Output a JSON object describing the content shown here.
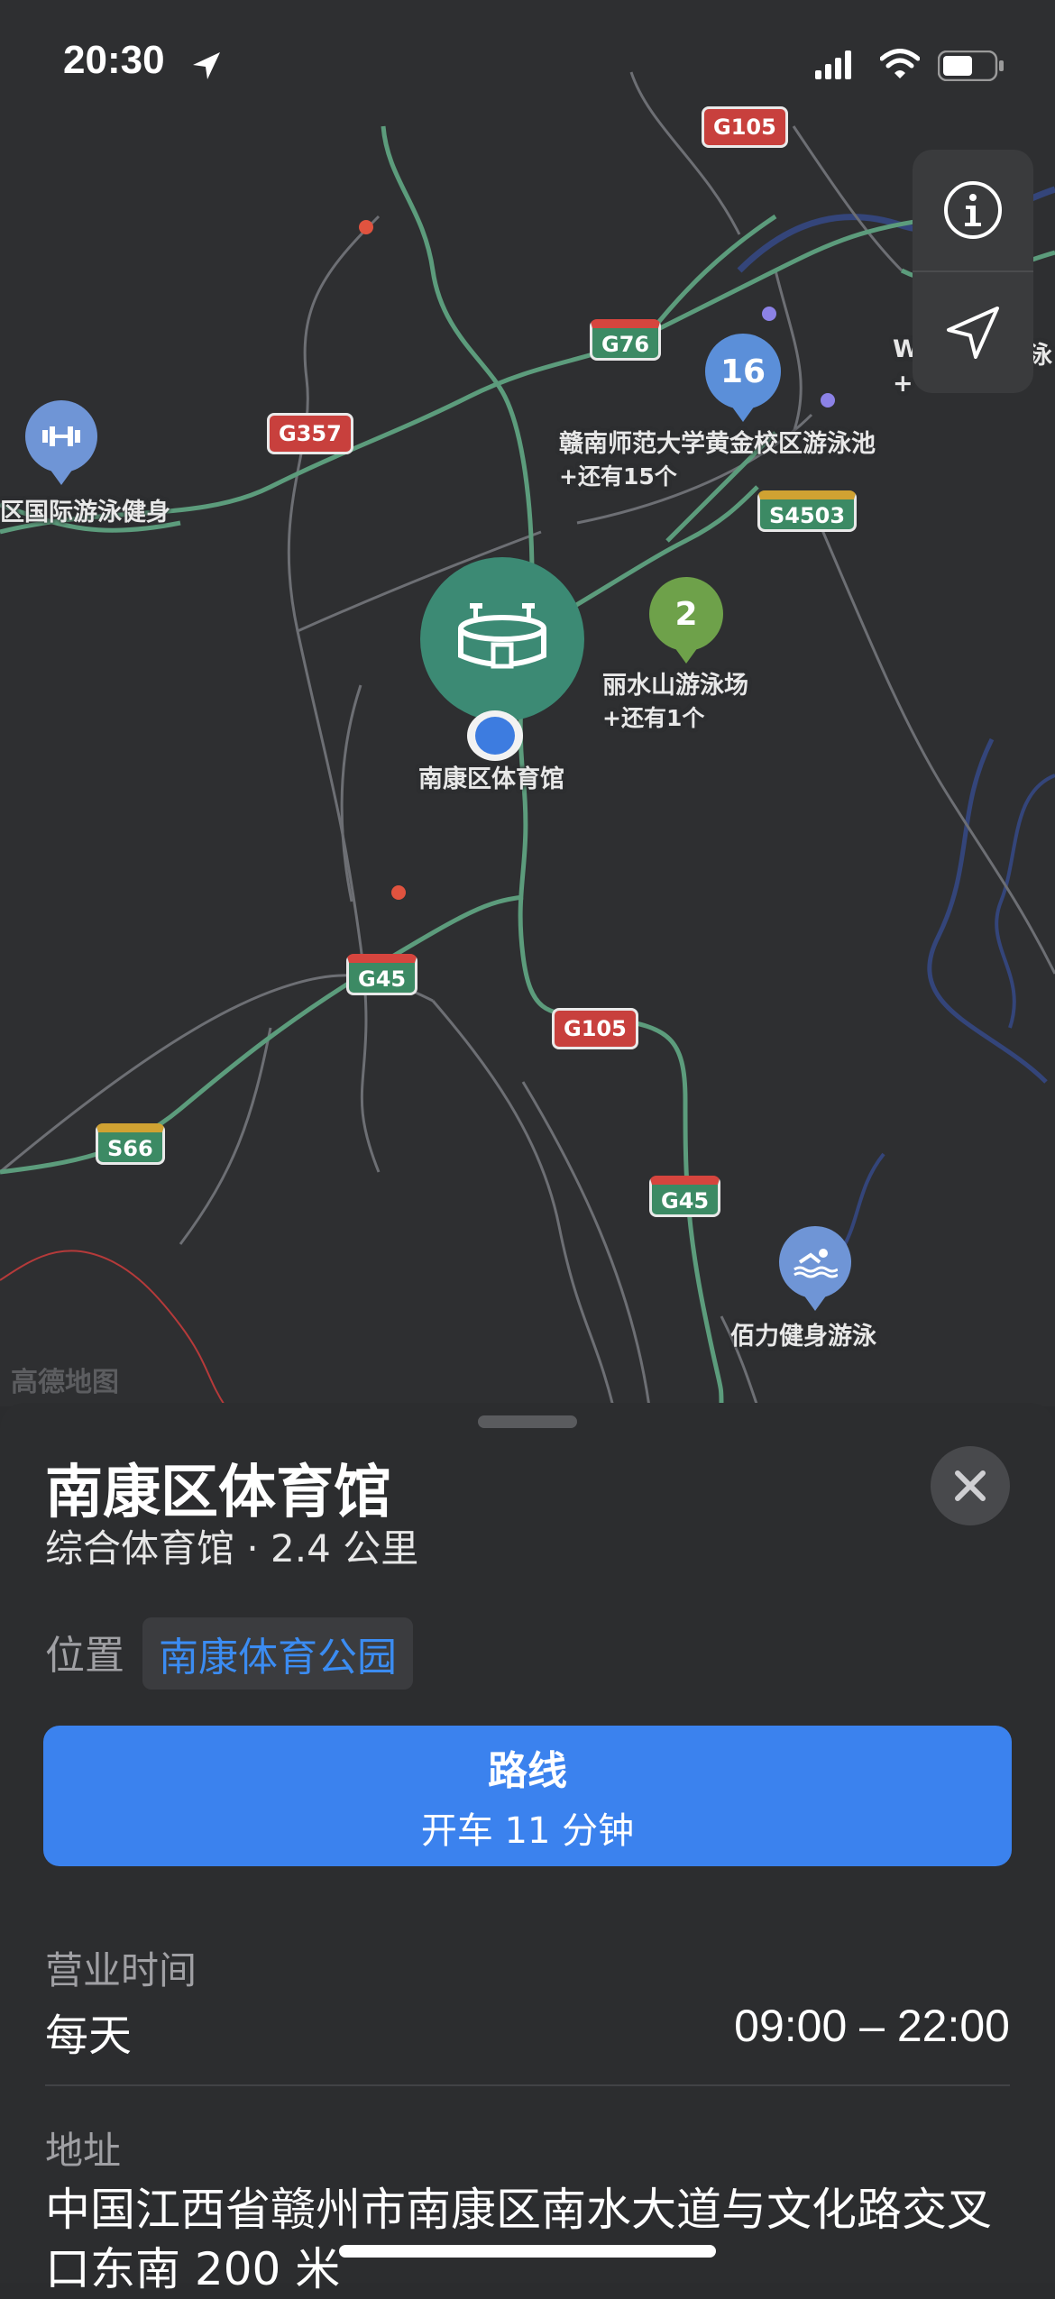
{
  "status_bar": {
    "time": "20:30"
  },
  "map": {
    "watermark": "高德地图",
    "shields": [
      {
        "id": "g105-top",
        "text": "G105"
      },
      {
        "id": "g76",
        "text": "G76"
      },
      {
        "id": "g357",
        "text": "G357"
      },
      {
        "id": "s4503",
        "text": "S4503"
      },
      {
        "id": "g45-a",
        "text": "G45"
      },
      {
        "id": "g105",
        "text": "G105"
      },
      {
        "id": "s66",
        "text": "S66"
      },
      {
        "id": "g45-b",
        "text": "G45"
      }
    ],
    "clusters": {
      "c16": {
        "count": "16",
        "label": "赣南师范大学黄金校区游泳池",
        "more": "+还有15个",
        "color": "#5b8fd9"
      },
      "c2": {
        "count": "2",
        "label": "丽水山游泳场",
        "more": "+还有1个",
        "color": "#6ea14a"
      }
    },
    "pois": {
      "gym_left_label": "区国际游泳健身",
      "selected_label": "南康区体育馆",
      "swim_label": "佰力健身游泳",
      "top_right_partial": "W",
      "top_right_partial_b": "泳",
      "top_right_partial_c": "+"
    },
    "colors": {
      "road_major": "#5c9c7c",
      "road_minor": "#6d6f74",
      "river": "#34457a",
      "selected_pin": "#3c8a74"
    }
  },
  "sheet": {
    "title": "南康区体育馆",
    "subtitle": "综合体育馆 · 2.4 公里",
    "location_label": "位置",
    "location_value": "南康体育公园",
    "route_title": "路线",
    "route_subtitle": "开车 11 分钟",
    "hours_label": "营业时间",
    "hours_days": "每天",
    "hours_time": "09:00 – 22:00",
    "address_label": "地址",
    "address_text": "中国江西省赣州市南康区南水大道与文化路交叉口东南 200 米"
  }
}
